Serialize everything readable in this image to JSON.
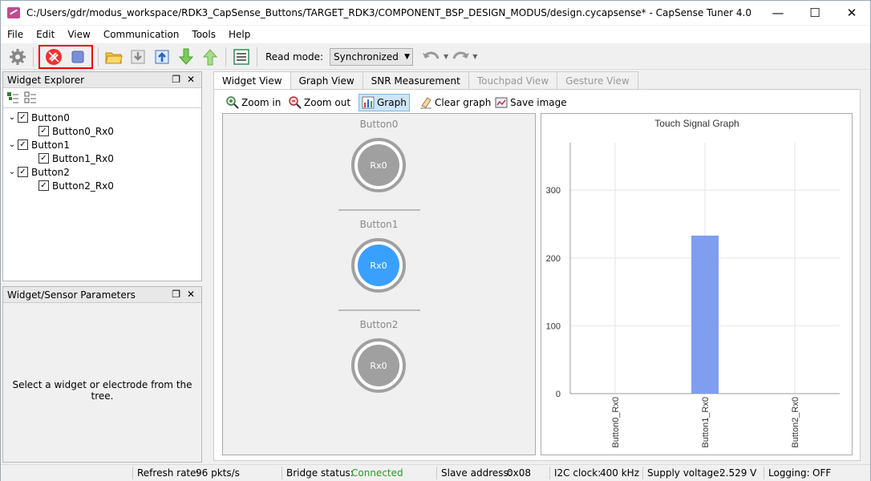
{
  "window": {
    "title": "C:/Users/gdr/modus_workspace/RDK3_CapSense_Buttons/TARGET_RDK3/COMPONENT_BSP_DESIGN_MODUS/design.cycapsense* - CapSense Tuner 4.0"
  },
  "menu": [
    "File",
    "Edit",
    "View",
    "Communication",
    "Tools",
    "Help"
  ],
  "toolbar": {
    "read_mode_label": "Read mode:",
    "read_mode_value": "Synchronized"
  },
  "widget_explorer": {
    "title": "Widget Explorer",
    "tree": [
      {
        "label": "Button0",
        "child": "Button0_Rx0"
      },
      {
        "label": "Button1",
        "child": "Button1_Rx0"
      },
      {
        "label": "Button2",
        "child": "Button2_Rx0"
      }
    ]
  },
  "params_panel": {
    "title": "Widget/Sensor Parameters",
    "message": "Select a widget or electrode from the tree."
  },
  "tabs": [
    {
      "label": "Widget View",
      "state": "active"
    },
    {
      "label": "Graph View",
      "state": "normal"
    },
    {
      "label": "SNR Measurement",
      "state": "normal"
    },
    {
      "label": "Touchpad View",
      "state": "disabled"
    },
    {
      "label": "Gesture View",
      "state": "disabled"
    }
  ],
  "graph_tools": {
    "zoom_in": "Zoom in",
    "zoom_out": "Zoom out",
    "graph": "Graph",
    "clear_graph": "Clear graph",
    "save_image": "Save image"
  },
  "widgets": [
    {
      "name": "Button0",
      "sensor": "Rx0",
      "active": false
    },
    {
      "name": "Button1",
      "sensor": "Rx0",
      "active": true
    },
    {
      "name": "Button2",
      "sensor": "Rx0",
      "active": false
    }
  ],
  "chart_data": {
    "type": "bar",
    "title": "Touch Signal Graph",
    "categories": [
      "Button0_Rx0",
      "Button1_Rx0",
      "Button2_Rx0"
    ],
    "values": [
      0,
      233,
      0
    ],
    "ylim": [
      0,
      370
    ],
    "yticks": [
      0,
      100,
      200,
      300
    ],
    "bar_color": "#7f9ef0",
    "grid": true
  },
  "status": {
    "refresh_label": "Refresh rate:",
    "refresh_value": "96 pkts/s",
    "bridge_label": "Bridge status:",
    "bridge_value": "Connected",
    "slave_label": "Slave address:",
    "slave_value": "0x08",
    "i2c_label": "I2C clock:",
    "i2c_value": "400 kHz",
    "supply_label": "Supply voltage:",
    "supply_value": "2.529 V",
    "logging_label": "Logging:",
    "logging_value": "OFF",
    "connected_color": "#2a9a2a"
  }
}
